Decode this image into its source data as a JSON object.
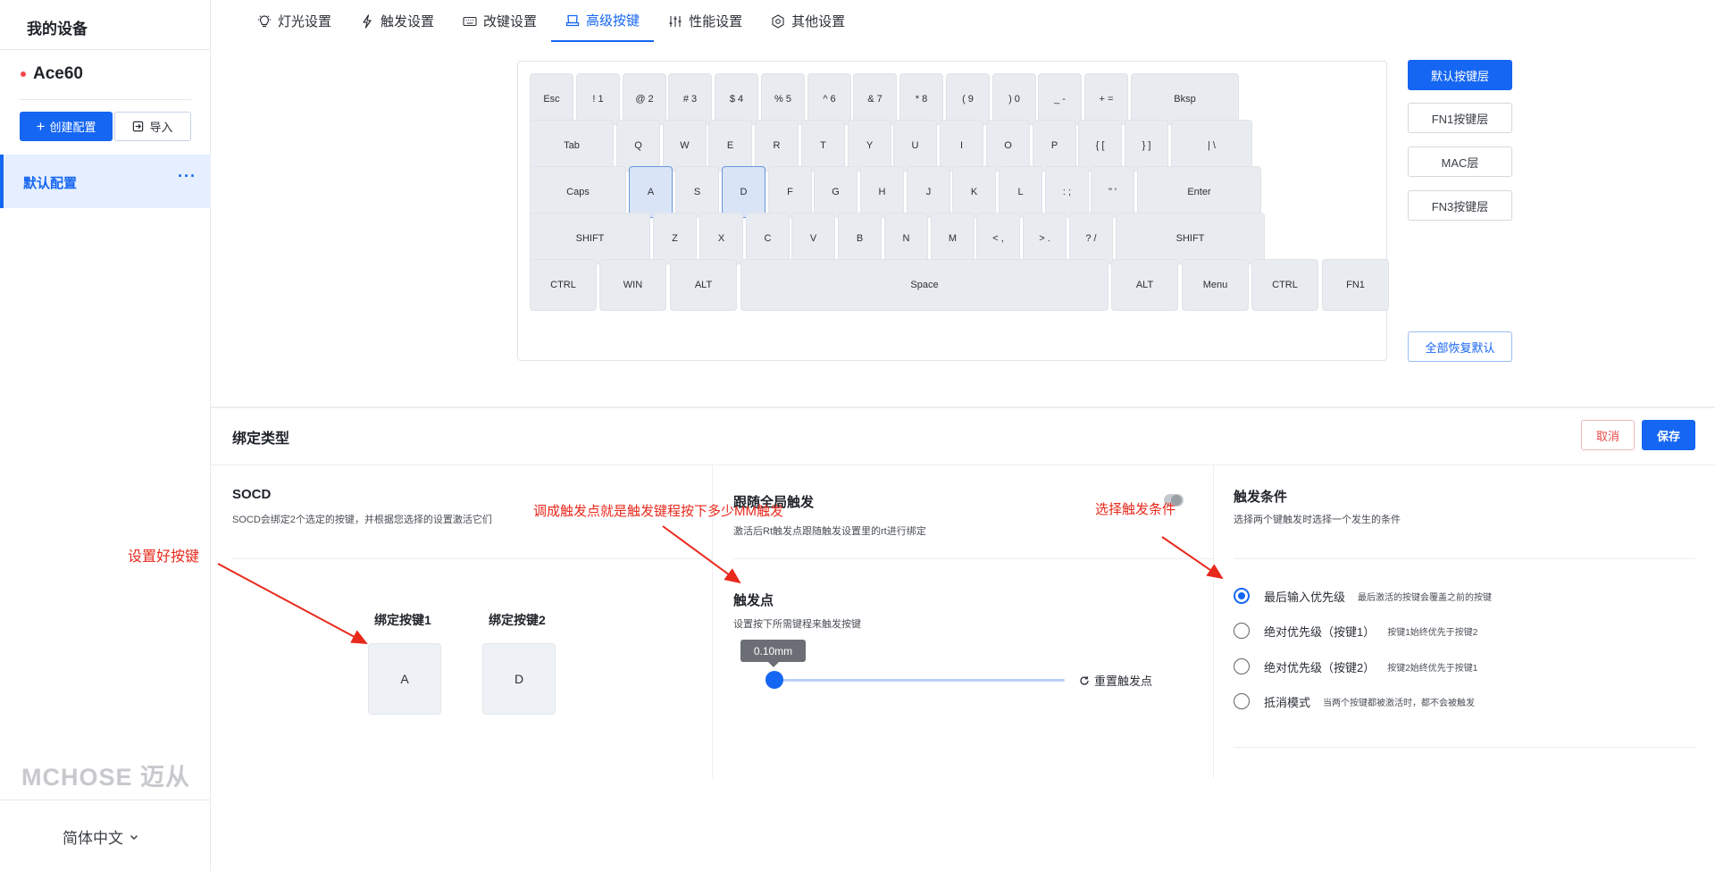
{
  "sidebar": {
    "title": "我的设备",
    "device_name": "Ace60",
    "create_label": "创建配置",
    "import_label": "导入",
    "config_item": "默认配置",
    "brand": "MCHOSE 迈从",
    "language": "简体中文"
  },
  "tabs": [
    {
      "label": "灯光设置",
      "icon": "lightbulb-icon"
    },
    {
      "label": "触发设置",
      "icon": "lightning-icon"
    },
    {
      "label": "改键设置",
      "icon": "keyboard-icon"
    },
    {
      "label": "高级按键",
      "icon": "keycap-icon",
      "active": true
    },
    {
      "label": "性能设置",
      "icon": "sliders-icon"
    },
    {
      "label": "其他设置",
      "icon": "gear-icon"
    }
  ],
  "keyboard": {
    "rows": [
      [
        "Esc",
        "! 1",
        "@ 2",
        "# 3",
        "$ 4",
        "% 5",
        "^ 6",
        "& 7",
        "* 8",
        "( 9",
        ") 0",
        "_ -",
        "+ =",
        "Bksp"
      ],
      [
        "Tab",
        "Q",
        "W",
        "E",
        "R",
        "T",
        "Y",
        "U",
        "I",
        "O",
        "P",
        "{ [",
        "} ]",
        "| \\"
      ],
      [
        "Caps",
        "A",
        "S",
        "D",
        "F",
        "G",
        "H",
        "J",
        "K",
        "L",
        ": ;",
        "\" '",
        "Enter"
      ],
      [
        "SHIFT",
        "Z",
        "X",
        "C",
        "V",
        "B",
        "N",
        "M",
        "< ,",
        "> .",
        "? /",
        "SHIFT"
      ],
      [
        "CTRL",
        "WIN",
        "ALT",
        "Space",
        "ALT",
        "Menu",
        "CTRL",
        "FN1"
      ]
    ],
    "selected": [
      "A",
      "D"
    ]
  },
  "layers": {
    "default": "默认按键层",
    "fn1": "FN1按键层",
    "mac": "MAC层",
    "fn3": "FN3按键层",
    "reset_all": "全部恢复默认"
  },
  "binding": {
    "title": "绑定类型",
    "cancel": "取消",
    "save": "保存",
    "socd_title": "SOCD",
    "socd_desc": "SOCD会绑定2个选定的按键，并根据您选择的设置激活它们",
    "key1_label": "绑定按键1",
    "key1_value": "A",
    "key2_label": "绑定按键2",
    "key2_value": "D",
    "follow_title": "跟随全局触发",
    "follow_desc": "激活后Rt触发点跟随触发设置里的rt进行绑定",
    "actuation_title": "触发点",
    "actuation_desc": "设置按下所需键程来触发按键",
    "actuation_value": "0.10mm",
    "actuation_fraction": 0.0,
    "reset_actuation": "重置触发点",
    "cond_title": "触发条件",
    "cond_desc": "选择两个键触发时选择一个发生的条件",
    "options": [
      {
        "label": "最后输入优先级",
        "desc": "最后激活的按键会覆盖之前的按键",
        "checked": true
      },
      {
        "label": "绝对优先级（按键1）",
        "desc": "按键1始终优先于按键2",
        "checked": false
      },
      {
        "label": "绝对优先级（按键2）",
        "desc": "按键2始终优先于按键1",
        "checked": false
      },
      {
        "label": "抵消模式",
        "desc": "当两个按键都被激活时，都不会被触发",
        "checked": false
      }
    ]
  },
  "annotations": {
    "a1": "设置好按键",
    "a2": "调成触发点就是触发键程按下多少MM触发",
    "a3": "选择触发条件",
    "color": "#e8291c"
  }
}
